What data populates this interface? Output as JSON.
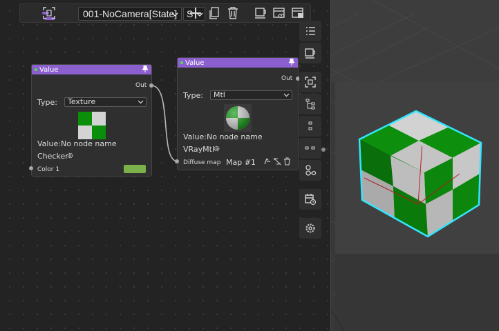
{
  "toolbar": {
    "scene_name": "001-NoCamera[State]",
    "state_short": "S",
    "icons": [
      "menu-icon",
      "select-frame-icon",
      "add-icon",
      "copy-icon",
      "delete-icon",
      "preview-icon",
      "view-icon",
      "render-settings-icon"
    ]
  },
  "node_left": {
    "title": "Value",
    "out_label": "Out",
    "type_label": "Type:",
    "type_value": "Texture",
    "value_label": "Value:",
    "value_text": "No node name",
    "material_label": "Checker",
    "port_label": "Color 1",
    "swatch_color": "#7bb04a"
  },
  "node_right": {
    "title": "Value",
    "out_label": "Out",
    "type_label": "Type:",
    "type_value": "Mtl",
    "value_label": "Value:",
    "value_text": "No node name",
    "material_label": "VRayMtl",
    "port_label": "Diffuse map",
    "map_label": "Map #1"
  },
  "side_panel": {
    "icons": [
      "list-icon",
      "material-preview-icon",
      "frame-select-icon",
      "tree-layout-icon",
      "vertical-layout-icon",
      "horizontal-layout-icon",
      "connect-icon",
      "history-icon",
      "settings-icon"
    ]
  },
  "colors": {
    "header": "#8c5fcf",
    "checker_green": "#0b8f0b",
    "checker_light": "#d3d3d3",
    "selection_cyan": "#33e5ff"
  }
}
